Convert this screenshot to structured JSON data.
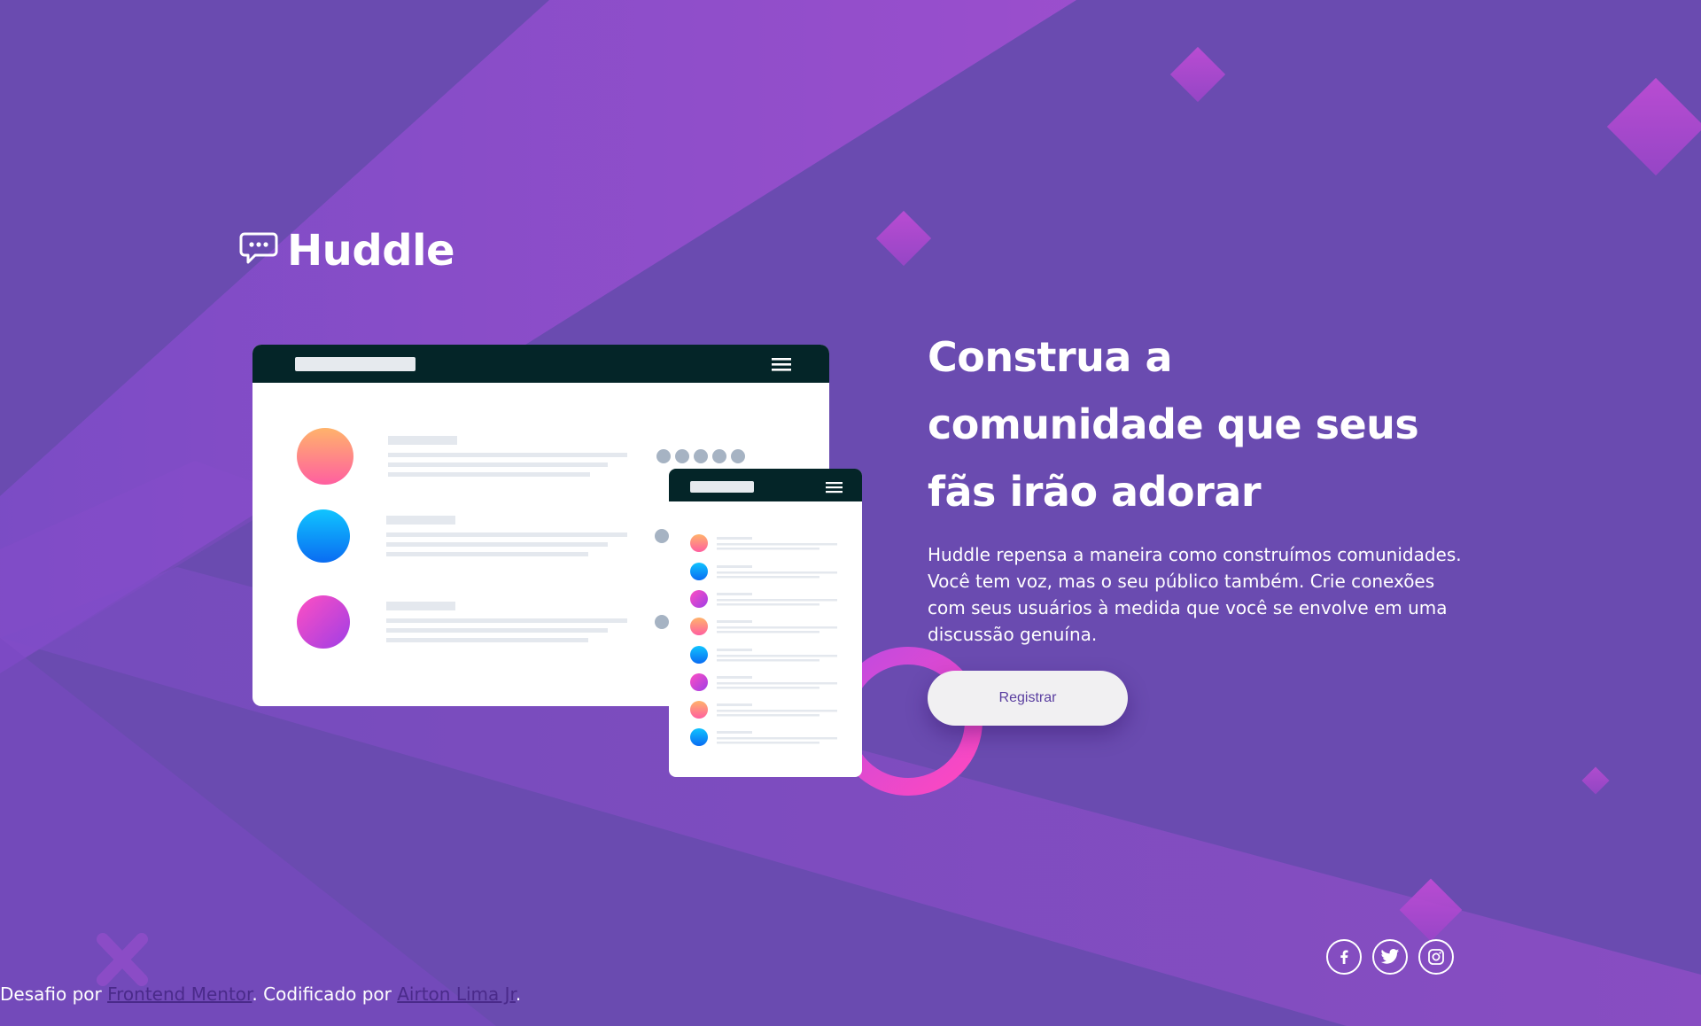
{
  "brand": {
    "name": "Huddle",
    "logo_icon": "chat-bubble-icon"
  },
  "hero": {
    "headline": "Construa a comunidade que seus fãs irão adorar",
    "description": "Huddle repensa a maneira como construímos comunidades. Você tem voz, mas o seu público também. Crie conexões com seus usuários à medida que você se envolve em uma discussão genuína.",
    "cta_label": "Registrar"
  },
  "social": [
    {
      "name": "facebook",
      "icon": "facebook-icon"
    },
    {
      "name": "twitter",
      "icon": "twitter-icon"
    },
    {
      "name": "instagram",
      "icon": "instagram-icon"
    }
  ],
  "attribution": {
    "prefix": "Desafio por ",
    "challenge_link": "Frontend Mentor",
    "middle": ". Codificado por ",
    "author_link": "Airton Lima Jr",
    "suffix": "."
  },
  "colors": {
    "background": "#6a4bb0",
    "accent_pink": "#e040c8",
    "button_bg": "#f1f0f2",
    "button_text": "#5a3ea0",
    "mockup_header": "#042528"
  }
}
